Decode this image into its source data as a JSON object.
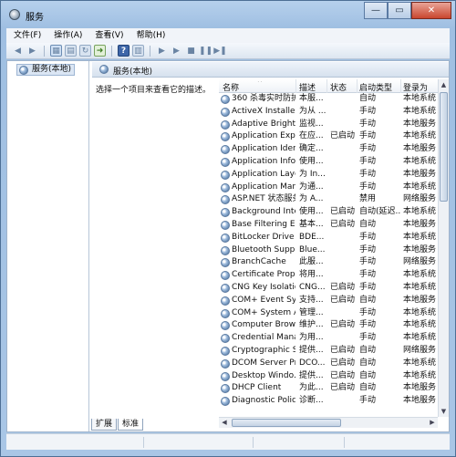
{
  "window": {
    "title": "服务",
    "close_label": "✕",
    "minimize_label": "—",
    "maximize_label": "▭"
  },
  "menu": [
    "文件(F)",
    "操作(A)",
    "查看(V)",
    "帮助(H)"
  ],
  "tree": {
    "item": "服务(本地)"
  },
  "pane": {
    "title": "服务(本地)",
    "description": "选择一个项目来查看它的描述。"
  },
  "columns": [
    "名称",
    "描述",
    "状态",
    "启动类型",
    "登录为"
  ],
  "services": [
    [
      "360 杀毒实时防护...",
      "本服...",
      "",
      "自动",
      "本地系统"
    ],
    [
      "ActiveX Installer ...",
      "为从 ...",
      "",
      "手动",
      "本地系统"
    ],
    [
      "Adaptive Brightn...",
      "监视...",
      "",
      "手动",
      "本地服务"
    ],
    [
      "Application Expe...",
      "在应...",
      "已启动",
      "手动",
      "本地系统"
    ],
    [
      "Application Iden...",
      "确定...",
      "",
      "手动",
      "本地服务"
    ],
    [
      "Application Infor...",
      "使用...",
      "",
      "手动",
      "本地系统"
    ],
    [
      "Application Laye...",
      "为 In...",
      "",
      "手动",
      "本地服务"
    ],
    [
      "Application Man...",
      "为通...",
      "",
      "手动",
      "本地系统"
    ],
    [
      "ASP.NET 状态服务",
      "为 A...",
      "",
      "禁用",
      "网络服务"
    ],
    [
      "Background Inte...",
      "使用...",
      "已启动",
      "自动(延迟...",
      "本地系统"
    ],
    [
      "Base Filtering En...",
      "基本...",
      "已启动",
      "自动",
      "本地服务"
    ],
    [
      "BitLocker Drive ...",
      "BDE...",
      "",
      "手动",
      "本地系统"
    ],
    [
      "Bluetooth Supp...",
      "Blue...",
      "",
      "手动",
      "本地服务"
    ],
    [
      "BranchCache",
      "此服...",
      "",
      "手动",
      "网络服务"
    ],
    [
      "Certificate Propa...",
      "将用...",
      "",
      "手动",
      "本地系统"
    ],
    [
      "CNG Key Isolation",
      "CNG...",
      "已启动",
      "手动",
      "本地系统"
    ],
    [
      "COM+ Event Sys...",
      "支持...",
      "已启动",
      "自动",
      "本地服务"
    ],
    [
      "COM+ System A...",
      "管理...",
      "",
      "手动",
      "本地系统"
    ],
    [
      "Computer Brow...",
      "维护...",
      "已启动",
      "手动",
      "本地系统"
    ],
    [
      "Credential Mana...",
      "为用...",
      "",
      "手动",
      "本地系统"
    ],
    [
      "Cryptographic S...",
      "提供...",
      "已启动",
      "自动",
      "网络服务"
    ],
    [
      "DCOM Server Pr...",
      "DCO...",
      "已启动",
      "自动",
      "本地系统"
    ],
    [
      "Desktop Windo...",
      "提供...",
      "已启动",
      "自动",
      "本地系统"
    ],
    [
      "DHCP Client",
      "为此...",
      "已启动",
      "自动",
      "本地服务"
    ],
    [
      "Diagnostic Polic...",
      "诊断...",
      "",
      "手动",
      "本地服务"
    ]
  ],
  "tabs": [
    "扩展",
    "标准"
  ]
}
